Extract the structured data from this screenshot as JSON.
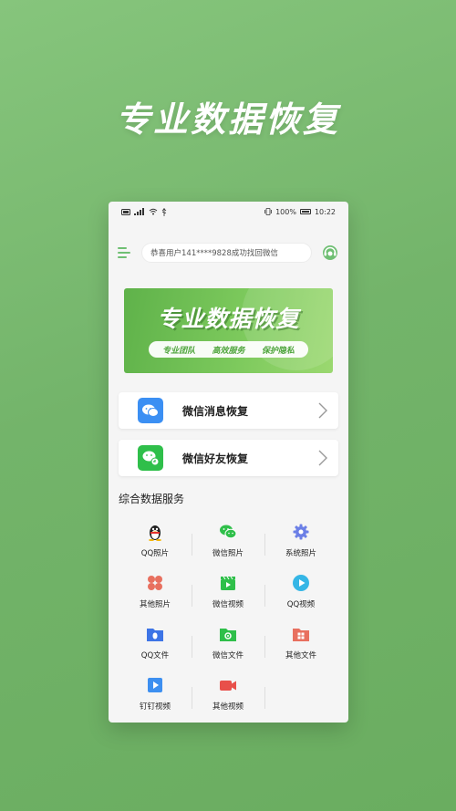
{
  "headline": "专业数据恢复",
  "status": {
    "time": "10:22",
    "battery": "100%"
  },
  "notice": "恭喜用户141****9828成功找回微信",
  "banner": {
    "title": "专业数据恢复",
    "tags": [
      "专业团队",
      "高效服务",
      "保护隐私"
    ]
  },
  "cards": [
    {
      "label": "微信消息恢复",
      "icon": "wechat-message-icon",
      "color": "#3b8ff3"
    },
    {
      "label": "微信好友恢复",
      "icon": "wechat-friend-icon",
      "color": "#2fbf4a"
    }
  ],
  "section_title": "综合数据服务",
  "services": [
    {
      "label": "QQ照片",
      "icon": "qq-penguin-icon"
    },
    {
      "label": "微信照片",
      "icon": "wechat-icon"
    },
    {
      "label": "系统照片",
      "icon": "gear-icon"
    },
    {
      "label": "其他照片",
      "icon": "petals-icon"
    },
    {
      "label": "微信视频",
      "icon": "video-clap-icon"
    },
    {
      "label": "QQ视频",
      "icon": "play-circle-icon"
    },
    {
      "label": "QQ文件",
      "icon": "qq-folder-icon"
    },
    {
      "label": "微信文件",
      "icon": "wechat-folder-icon"
    },
    {
      "label": "其他文件",
      "icon": "other-folder-icon"
    },
    {
      "label": "钉钉视频",
      "icon": "dingtalk-video-icon"
    },
    {
      "label": "其他视频",
      "icon": "camera-icon"
    }
  ],
  "colors": {
    "accent": "#6fbf73",
    "background": "#7bb971",
    "banner": "#6bbd52"
  }
}
